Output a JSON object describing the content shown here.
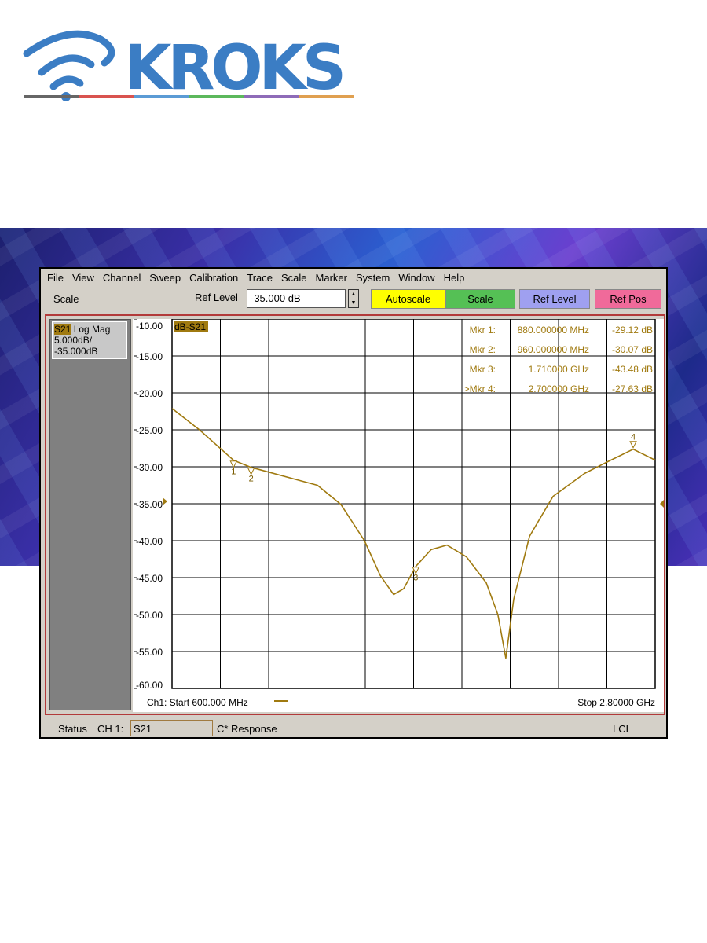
{
  "brand": {
    "name": "KROKS",
    "colors": {
      "blue": "#3b7dc4",
      "stripe": [
        "#666666",
        "#d9534f",
        "#5b9bd5",
        "#5cb85c",
        "#8e6bb8",
        "#e0a050"
      ]
    }
  },
  "menu": [
    "File",
    "View",
    "Channel",
    "Sweep",
    "Calibration",
    "Trace",
    "Scale",
    "Marker",
    "System",
    "Window",
    "Help"
  ],
  "toolbar": {
    "section": "Scale",
    "ref_level_label": "Ref Level",
    "ref_level_value": "-35.000 dB",
    "buttons": [
      {
        "label": "Autoscale",
        "color": "#ffff00"
      },
      {
        "label": "Scale",
        "color": "#55c055"
      },
      {
        "label": "Ref Level",
        "color": "#9fa0f0"
      },
      {
        "label": "Ref Pos",
        "color": "#f06a9a"
      }
    ]
  },
  "trace_info": {
    "param": "S21",
    "format": "Log Mag",
    "scale": "5.000dB/",
    "ref": "-35.000dB"
  },
  "status": {
    "label": "Status",
    "channel": "CH 1:",
    "param": "S21",
    "response": "C* Response",
    "mode": "LCL"
  },
  "chart_data": {
    "type": "line",
    "title": "dB-S21",
    "trace_color": "#a07a10",
    "y_ticks": [
      "-10.00",
      "-15.00",
      "-20.00",
      "-25.00",
      "-30.00",
      "-35.00",
      "-40.00",
      "-45.00",
      "-50.00",
      "-55.00",
      "-60.00"
    ],
    "ylim": [
      -60,
      -10
    ],
    "xlim_mhz": [
      600,
      2800
    ],
    "start_label": "Ch1: Start  600.000 MHz",
    "stop_label": "Stop  2.80000 GHz",
    "ref_level": -35,
    "x_mhz": [
      600,
      725,
      880,
      960,
      1262,
      1369,
      1476,
      1548,
      1609,
      1655,
      1710,
      1780,
      1852,
      1941,
      2031,
      2084,
      2120,
      2156,
      2228,
      2335,
      2478,
      2585,
      2700,
      2800
    ],
    "y_db": [
      -22.1,
      -25,
      -29.12,
      -30.07,
      -32.5,
      -35.1,
      -40,
      -44.7,
      -47.3,
      -46.5,
      -43.48,
      -41.2,
      -40.6,
      -42.2,
      -45.7,
      -50,
      -55.9,
      -47.9,
      -39.4,
      -34,
      -30.9,
      -29.3,
      -27.63,
      -29.1
    ],
    "markers": [
      {
        "id": "1",
        "label": "Mkr  1:",
        "freq_mhz": 880,
        "freq": "880.000000 MHz",
        "value_db": -29.12,
        "value": "-29.12 dB"
      },
      {
        "id": "2",
        "label": "Mkr  2:",
        "freq_mhz": 960,
        "freq": "960.000000 MHz",
        "value_db": -30.07,
        "value": "-30.07 dB"
      },
      {
        "id": "3",
        "label": "Mkr  3:",
        "freq_mhz": 1710,
        "freq": "1.710000 GHz",
        "value_db": -43.48,
        "value": "-43.48 dB"
      },
      {
        "id": "4",
        "label": ">Mkr  4:",
        "freq_mhz": 2700,
        "freq": "2.700000 GHz",
        "value_db": -27.63,
        "value": "-27.63 dB"
      }
    ]
  }
}
